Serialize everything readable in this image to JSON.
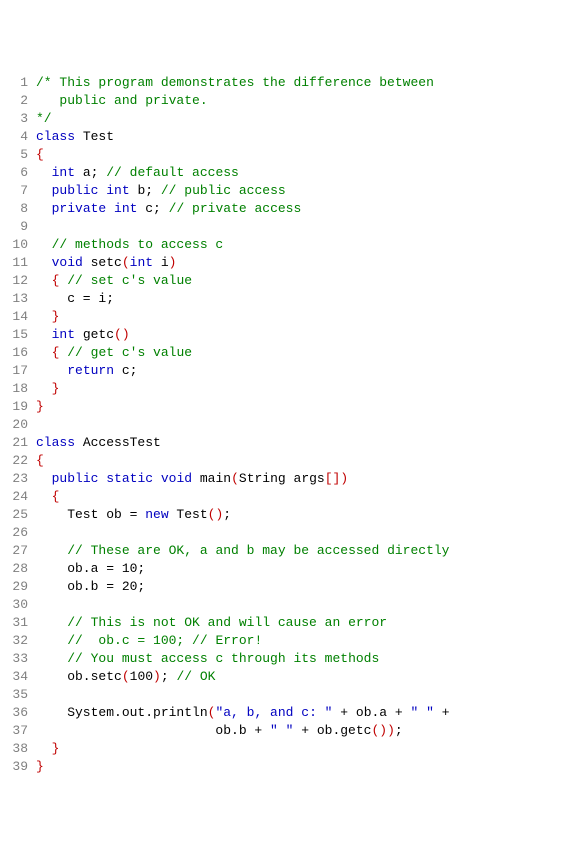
{
  "code_lines": [
    [
      {
        "c": "cm",
        "t": "/* This program demonstrates the difference between"
      }
    ],
    [
      {
        "c": "cm",
        "t": "   public and private."
      }
    ],
    [
      {
        "c": "cm",
        "t": "*/"
      }
    ],
    [
      {
        "c": "kw",
        "t": "class"
      },
      {
        "c": "id",
        "t": " Test"
      }
    ],
    [
      {
        "c": "br",
        "t": "{"
      }
    ],
    [
      {
        "c": "id",
        "t": "  "
      },
      {
        "c": "kw",
        "t": "int"
      },
      {
        "c": "id",
        "t": " a; "
      },
      {
        "c": "cm",
        "t": "// default access"
      }
    ],
    [
      {
        "c": "id",
        "t": "  "
      },
      {
        "c": "kw",
        "t": "public"
      },
      {
        "c": "id",
        "t": " "
      },
      {
        "c": "kw",
        "t": "int"
      },
      {
        "c": "id",
        "t": " b; "
      },
      {
        "c": "cm",
        "t": "// public access"
      }
    ],
    [
      {
        "c": "id",
        "t": "  "
      },
      {
        "c": "kw",
        "t": "private"
      },
      {
        "c": "id",
        "t": " "
      },
      {
        "c": "kw",
        "t": "int"
      },
      {
        "c": "id",
        "t": " c; "
      },
      {
        "c": "cm",
        "t": "// private access"
      }
    ],
    [],
    [
      {
        "c": "id",
        "t": "  "
      },
      {
        "c": "cm",
        "t": "// methods to access c"
      }
    ],
    [
      {
        "c": "id",
        "t": "  "
      },
      {
        "c": "kw",
        "t": "void"
      },
      {
        "c": "id",
        "t": " setc"
      },
      {
        "c": "br",
        "t": "("
      },
      {
        "c": "kw",
        "t": "int"
      },
      {
        "c": "id",
        "t": " i"
      },
      {
        "c": "br",
        "t": ")"
      }
    ],
    [
      {
        "c": "id",
        "t": "  "
      },
      {
        "c": "br",
        "t": "{"
      },
      {
        "c": "id",
        "t": " "
      },
      {
        "c": "cm",
        "t": "// set c's value"
      }
    ],
    [
      {
        "c": "id",
        "t": "    c = i;"
      }
    ],
    [
      {
        "c": "id",
        "t": "  "
      },
      {
        "c": "br",
        "t": "}"
      }
    ],
    [
      {
        "c": "id",
        "t": "  "
      },
      {
        "c": "kw",
        "t": "int"
      },
      {
        "c": "id",
        "t": " getc"
      },
      {
        "c": "br",
        "t": "()"
      }
    ],
    [
      {
        "c": "id",
        "t": "  "
      },
      {
        "c": "br",
        "t": "{"
      },
      {
        "c": "id",
        "t": " "
      },
      {
        "c": "cm",
        "t": "// get c's value"
      }
    ],
    [
      {
        "c": "id",
        "t": "    "
      },
      {
        "c": "kw",
        "t": "return"
      },
      {
        "c": "id",
        "t": " c;"
      }
    ],
    [
      {
        "c": "id",
        "t": "  "
      },
      {
        "c": "br",
        "t": "}"
      }
    ],
    [
      {
        "c": "br",
        "t": "}"
      }
    ],
    [],
    [
      {
        "c": "kw",
        "t": "class"
      },
      {
        "c": "id",
        "t": " AccessTest"
      }
    ],
    [
      {
        "c": "br",
        "t": "{"
      }
    ],
    [
      {
        "c": "id",
        "t": "  "
      },
      {
        "c": "kw",
        "t": "public"
      },
      {
        "c": "id",
        "t": " "
      },
      {
        "c": "kw",
        "t": "static"
      },
      {
        "c": "id",
        "t": " "
      },
      {
        "c": "kw",
        "t": "void"
      },
      {
        "c": "id",
        "t": " main"
      },
      {
        "c": "br",
        "t": "("
      },
      {
        "c": "id",
        "t": "String args"
      },
      {
        "c": "br",
        "t": "[])"
      }
    ],
    [
      {
        "c": "id",
        "t": "  "
      },
      {
        "c": "br",
        "t": "{"
      }
    ],
    [
      {
        "c": "id",
        "t": "    Test ob = "
      },
      {
        "c": "kw",
        "t": "new"
      },
      {
        "c": "id",
        "t": " Test"
      },
      {
        "c": "br",
        "t": "()"
      },
      {
        "c": "id",
        "t": ";"
      }
    ],
    [],
    [
      {
        "c": "id",
        "t": "    "
      },
      {
        "c": "cm",
        "t": "// These are OK, a and b may be accessed directly"
      }
    ],
    [
      {
        "c": "id",
        "t": "    ob.a = 10;"
      }
    ],
    [
      {
        "c": "id",
        "t": "    ob.b = 20;"
      }
    ],
    [],
    [
      {
        "c": "id",
        "t": "    "
      },
      {
        "c": "cm",
        "t": "// This is not OK and will cause an error"
      }
    ],
    [
      {
        "c": "id",
        "t": "    "
      },
      {
        "c": "cm",
        "t": "//  ob.c = 100; // Error!"
      }
    ],
    [
      {
        "c": "id",
        "t": "    "
      },
      {
        "c": "cm",
        "t": "// You must access c through its methods"
      }
    ],
    [
      {
        "c": "id",
        "t": "    ob.setc"
      },
      {
        "c": "br",
        "t": "("
      },
      {
        "c": "id",
        "t": "100"
      },
      {
        "c": "br",
        "t": ")"
      },
      {
        "c": "id",
        "t": "; "
      },
      {
        "c": "cm",
        "t": "// OK"
      }
    ],
    [],
    [
      {
        "c": "id",
        "t": "    System.out.println"
      },
      {
        "c": "br",
        "t": "("
      },
      {
        "c": "st",
        "t": "\"a, b, and c: \""
      },
      {
        "c": "id",
        "t": " + ob.a + "
      },
      {
        "c": "st",
        "t": "\" \""
      },
      {
        "c": "id",
        "t": " +"
      }
    ],
    [
      {
        "c": "id",
        "t": "                       ob.b + "
      },
      {
        "c": "st",
        "t": "\" \""
      },
      {
        "c": "id",
        "t": " + ob.getc"
      },
      {
        "c": "br",
        "t": "())"
      },
      {
        "c": "id",
        "t": ";"
      }
    ],
    [
      {
        "c": "id",
        "t": "  "
      },
      {
        "c": "br",
        "t": "}"
      }
    ],
    [
      {
        "c": "br",
        "t": "}"
      }
    ]
  ]
}
